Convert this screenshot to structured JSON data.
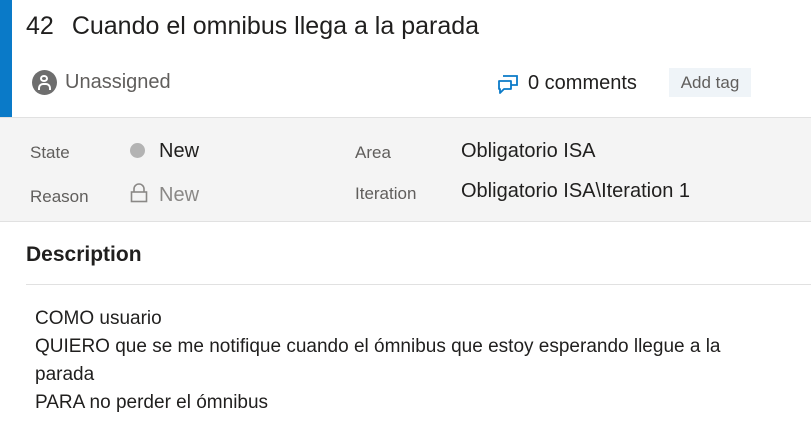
{
  "work_item": {
    "id": "42",
    "title": "Cuando el omnibus llega a la parada",
    "assignee": "Unassigned",
    "comments": "0 comments",
    "add_tag": "Add tag"
  },
  "fields": {
    "state_label": "State",
    "state_value": "New",
    "reason_label": "Reason",
    "reason_value": "New",
    "area_label": "Area",
    "area_value": "Obligatorio ISA",
    "iteration_label": "Iteration",
    "iteration_value": "Obligatorio ISA\\Iteration 1"
  },
  "description": {
    "heading": "Description",
    "lines": [
      "COMO usuario",
      "QUIERO que se me notifique cuando el ómnibus que estoy esperando llegue a la",
      "parada",
      "PARA no perder el ómnibus"
    ]
  },
  "colors": {
    "accent": "#0a7ac8",
    "state_dot": "#b3b3b3",
    "tag_bg": "#eff4f8"
  }
}
